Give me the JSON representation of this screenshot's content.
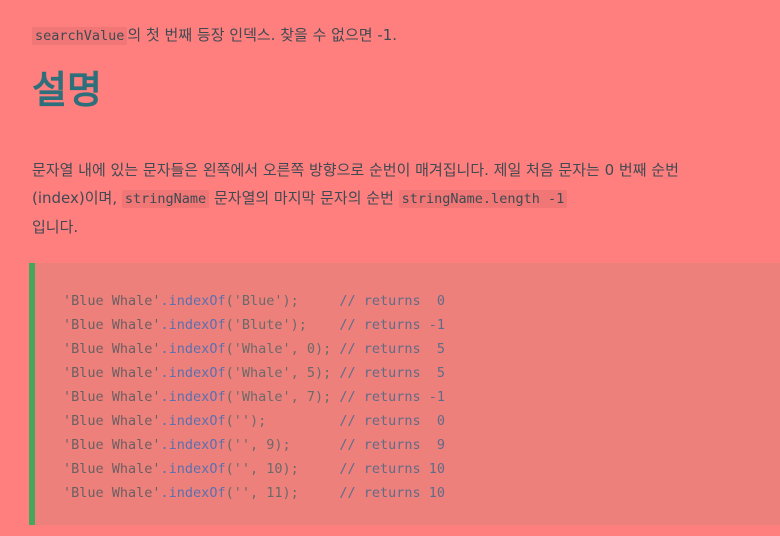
{
  "return_value": {
    "code": "searchValue",
    "text": "의 첫 번째 등장 인덱스. 찾을 수 없으면 -1."
  },
  "section": {
    "title": "설명"
  },
  "description": {
    "part1": "문자열 내에 있는 문자들은 왼쪽에서 오른쪽 방향으로 순번이 매겨집니다. 제일 처음 문자는 0 번째 순번(index)이며,",
    "code1": "stringName",
    "part2": "문자열의 마지막 문자의 순번",
    "code2": "stringName.length -1",
    "part3": "입니다."
  },
  "code_example": {
    "lines": [
      {
        "str": "'Blue Whale'",
        "method": ".indexOf",
        "args": "('Blue');     ",
        "comment": "// returns  0"
      },
      {
        "str": "'Blue Whale'",
        "method": ".indexOf",
        "args": "('Blute');    ",
        "comment": "// returns -1"
      },
      {
        "str": "'Blue Whale'",
        "method": ".indexOf",
        "args": "('Whale', 0); ",
        "comment": "// returns  5"
      },
      {
        "str": "'Blue Whale'",
        "method": ".indexOf",
        "args": "('Whale', 5); ",
        "comment": "// returns  5"
      },
      {
        "str": "'Blue Whale'",
        "method": ".indexOf",
        "args": "('Whale', 7); ",
        "comment": "// returns -1"
      },
      {
        "str": "'Blue Whale'",
        "method": ".indexOf",
        "args": "('');         ",
        "comment": "// returns  0"
      },
      {
        "str": "'Blue Whale'",
        "method": ".indexOf",
        "args": "('', 9);      ",
        "comment": "// returns  9"
      },
      {
        "str": "'Blue Whale'",
        "method": ".indexOf",
        "args": "('', 10);     ",
        "comment": "// returns 10"
      },
      {
        "str": "'Blue Whale'",
        "method": ".indexOf",
        "args": "('', 11);     ",
        "comment": "// returns 10"
      }
    ]
  },
  "colors": {
    "background": "#ff7f7e",
    "heading": "#2d6f7a",
    "code_border": "#46a65a",
    "code_background": "#ee807b"
  }
}
